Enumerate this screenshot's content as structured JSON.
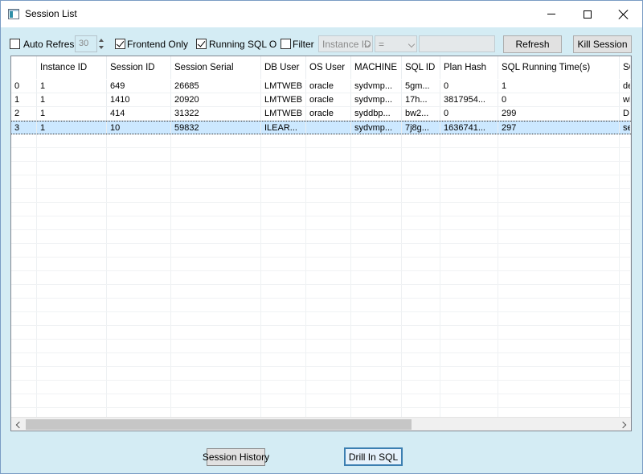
{
  "window": {
    "title": "Session List"
  },
  "toolbar": {
    "auto_refresh": {
      "label": "Auto Refresh",
      "checked": false
    },
    "interval_value": "30",
    "frontend_only": {
      "label": "Frontend Only",
      "checked": true
    },
    "running_sql_only": {
      "label": "Running SQL Only",
      "checked": true
    },
    "filter": {
      "label": "Filter",
      "checked": false
    },
    "filter_column": "Instance ID",
    "filter_operator": "=",
    "filter_value": "",
    "refresh_label": "Refresh",
    "kill_label": "Kill Session"
  },
  "table": {
    "columns": [
      "",
      "Instance ID",
      "Session ID",
      "Session Serial",
      "DB User",
      "OS User",
      "MACHINE",
      "SQL ID",
      "Plan Hash",
      "SQL Running Time(s)",
      "SQ"
    ],
    "rows": [
      [
        "0",
        "1",
        "649",
        "26685",
        "LMTWEB",
        "oracle",
        "sydvmp...",
        "5gm...",
        "0",
        "1",
        "de"
      ],
      [
        "1",
        "1",
        "1410",
        "20920",
        "LMTWEB",
        "oracle",
        "sydvmp...",
        "17h...",
        "3817954...",
        "0",
        "wi"
      ],
      [
        "2",
        "1",
        "414",
        "31322",
        "LMTWEB",
        "oracle",
        "syddbp...",
        "bw2...",
        "0",
        "299",
        "DI"
      ],
      [
        "3",
        "1",
        "10",
        "59832",
        "ILEAR...",
        "",
        "sydvmp...",
        "7j8g...",
        "1636741...",
        "297",
        "se"
      ]
    ],
    "selected_row": 3
  },
  "bottom": {
    "history_label": "Session History",
    "drill_label": "Drill In SQL"
  }
}
